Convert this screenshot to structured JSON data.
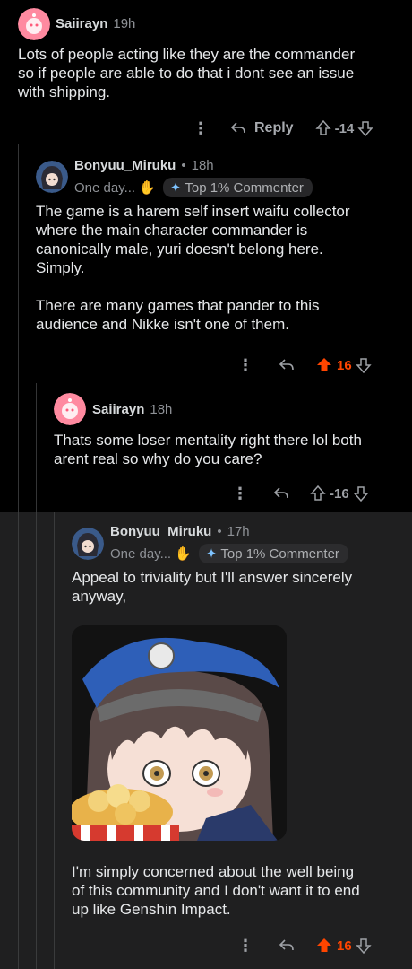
{
  "comments": [
    {
      "username": "Saiirayn",
      "time": "19h",
      "lines": [
        "Lots of people acting like they are the commander",
        "so if people are able to do that i dont see an issue",
        "with shipping."
      ],
      "reply_label": "Reply",
      "votes": "-14"
    },
    {
      "username": "Bonyuu_Miruku",
      "time": "18h",
      "flair_text": "One day...",
      "badge": "Top 1% Commenter",
      "lines": [
        "The game is a harem self insert waifu collector",
        "where the main character commander is",
        "canonically male, yuri doesn't belong here.",
        "Simply.",
        "",
        "There are many games that pander to this",
        "audience and Nikke isn't one of them."
      ],
      "votes": "16"
    },
    {
      "username": "Saiirayn",
      "time": "18h",
      "lines": [
        "Thats some loser mentality right there lol both",
        "arent real so why do you care?"
      ],
      "votes": "-16"
    },
    {
      "username": "Bonyuu_Miruku",
      "time": "17h",
      "flair_text": "One day...",
      "badge": "Top 1% Commenter",
      "lines_top": [
        "Appeal to triviality but I'll answer sincerely",
        "anyway,"
      ],
      "lines_bottom": [
        "I'm simply concerned about the well being",
        "of this community and I don't want it to end",
        "up like Genshin Impact."
      ],
      "votes": "16"
    }
  ],
  "separator": "•",
  "colors": {
    "upvote_active": "#ff4500",
    "background": "#000000",
    "panel": "#1f1f20"
  },
  "icons": [
    "more-icon",
    "reply-icon",
    "upvote-icon",
    "downvote-icon",
    "sparkle-badge-icon",
    "wave-hand-icon"
  ]
}
